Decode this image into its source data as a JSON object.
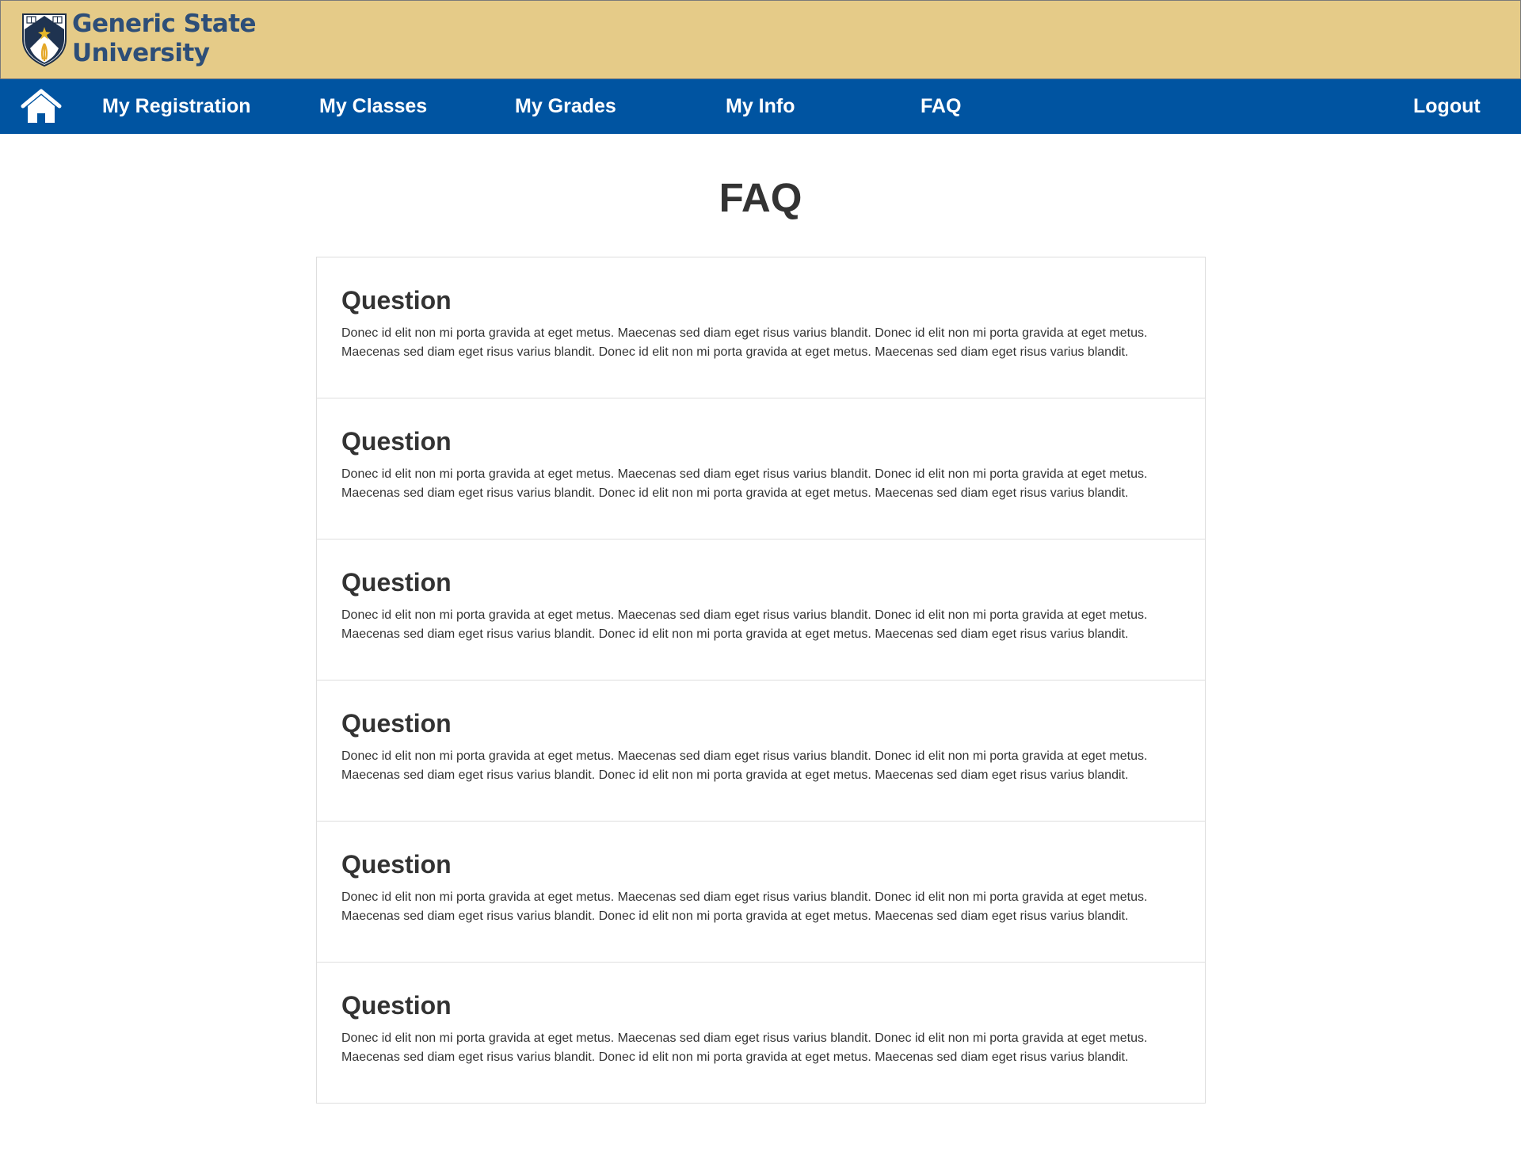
{
  "header": {
    "brand_line1": "Generic State",
    "brand_line2": "University"
  },
  "nav": {
    "home_icon": "home-icon",
    "items": [
      {
        "label": "My Registration"
      },
      {
        "label": "My Classes"
      },
      {
        "label": "My Grades"
      },
      {
        "label": "My Info"
      },
      {
        "label": "FAQ"
      }
    ],
    "logout": "Logout"
  },
  "page": {
    "title": "FAQ"
  },
  "faq": [
    {
      "question": "Question",
      "answer": "Donec id elit non mi porta gravida at eget metus. Maecenas sed diam eget risus varius blandit. Donec id elit non mi porta gravida at eget metus. Maecenas sed diam eget risus varius blandit. Donec id elit non mi porta gravida at eget metus. Maecenas sed diam eget risus varius blandit."
    },
    {
      "question": "Question",
      "answer": "Donec id elit non mi porta gravida at eget metus. Maecenas sed diam eget risus varius blandit. Donec id elit non mi porta gravida at eget metus. Maecenas sed diam eget risus varius blandit. Donec id elit non mi porta gravida at eget metus. Maecenas sed diam eget risus varius blandit."
    },
    {
      "question": "Question",
      "answer": "Donec id elit non mi porta gravida at eget metus. Maecenas sed diam eget risus varius blandit. Donec id elit non mi porta gravida at eget metus. Maecenas sed diam eget risus varius blandit. Donec id elit non mi porta gravida at eget metus. Maecenas sed diam eget risus varius blandit."
    },
    {
      "question": "Question",
      "answer": "Donec id elit non mi porta gravida at eget metus. Maecenas sed diam eget risus varius blandit. Donec id elit non mi porta gravida at eget metus. Maecenas sed diam eget risus varius blandit. Donec id elit non mi porta gravida at eget metus. Maecenas sed diam eget risus varius blandit."
    },
    {
      "question": "Question",
      "answer": "Donec id elit non mi porta gravida at eget metus. Maecenas sed diam eget risus varius blandit. Donec id elit non mi porta gravida at eget metus. Maecenas sed diam eget risus varius blandit. Donec id elit non mi porta gravida at eget metus. Maecenas sed diam eget risus varius blandit."
    },
    {
      "question": "Question",
      "answer": "Donec id elit non mi porta gravida at eget metus. Maecenas sed diam eget risus varius blandit. Donec id elit non mi porta gravida at eget metus. Maecenas sed diam eget risus varius blandit. Donec id elit non mi porta gravida at eget metus. Maecenas sed diam eget risus varius blandit."
    }
  ],
  "colors": {
    "header_bg": "#e5cb88",
    "brand_text": "#2d4e78",
    "nav_bg": "#0054a1",
    "nav_text": "#ffffff"
  }
}
